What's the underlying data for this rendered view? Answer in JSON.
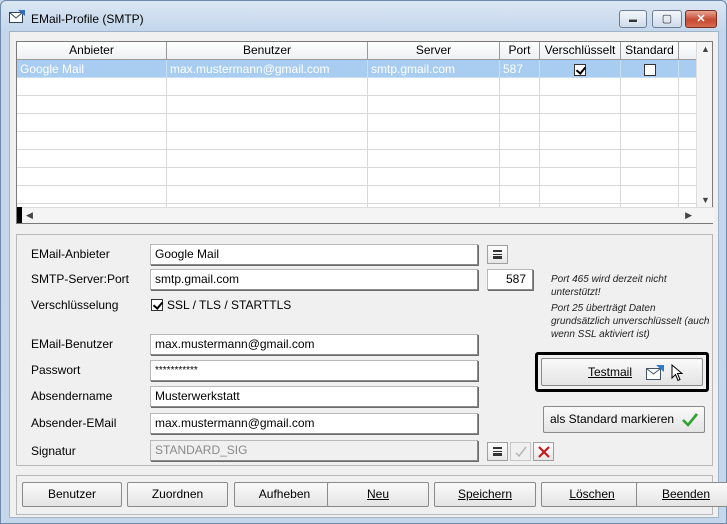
{
  "window": {
    "title": "EMail-Profile (SMTP)",
    "controls": {
      "minimize": "▬",
      "maximize": "▢",
      "close": "✕"
    }
  },
  "grid": {
    "columns": [
      "Anbieter",
      "Benutzer",
      "Server",
      "Port",
      "Verschlüsselt",
      "Standard"
    ],
    "rows": [
      {
        "anbieter": "Google Mail",
        "benutzer": "max.mustermann@gmail.com",
        "server": "smtp.gmail.com",
        "port": "587",
        "verschluesselt": true,
        "standard": false
      }
    ],
    "selection_color": "#a9cdf0"
  },
  "form": {
    "anbieter_label": "EMail-Anbieter",
    "anbieter_value": "Google Mail",
    "server_label": "SMTP-Server:Port",
    "server_value": "smtp.gmail.com",
    "port_value": "587",
    "encryption_label": "Verschlüsselung",
    "encryption_option": "SSL / TLS / STARTTLS",
    "encryption_checked": true,
    "user_label": "EMail-Benutzer",
    "user_value": "max.mustermann@gmail.com",
    "password_label": "Passwort",
    "password_value": "***********",
    "sender_name_label": "Absendername",
    "sender_name_value": "Musterwerkstatt",
    "sender_email_label": "Absender-EMail",
    "sender_email_value": "max.mustermann@gmail.com",
    "signature_label": "Signatur",
    "signature_value": "STANDARD_SIG",
    "note1": "Port 465 wird derzeit nicht unterstützt!",
    "note2": "Port 25 überträgt Daten grundsätzlich unverschlüsselt (auch wenn SSL aktiviert ist)",
    "testmail_label": "Testmail",
    "standard_label": "als Standard markieren"
  },
  "buttons": {
    "benutzer": "Benutzer",
    "zuordnen": "Zuordnen",
    "aufheben": "Aufheben",
    "neu": "Neu",
    "speichern": "Speichern",
    "loeschen": "Löschen",
    "beenden": "Beenden"
  }
}
